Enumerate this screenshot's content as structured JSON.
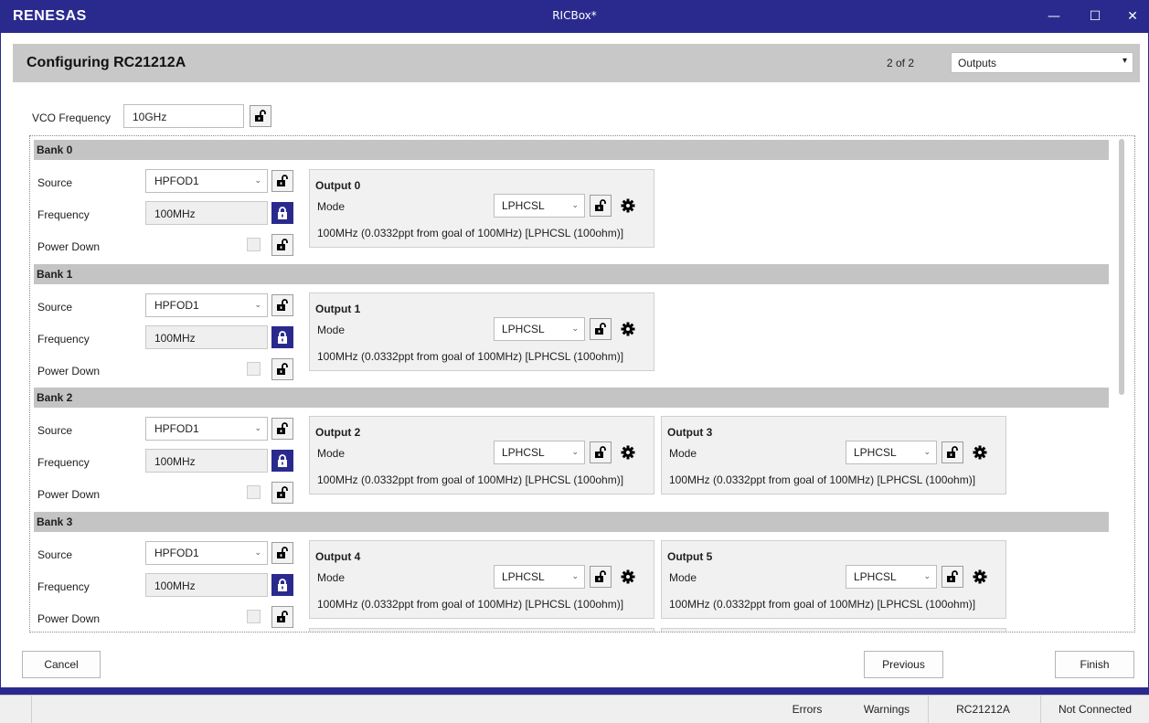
{
  "window": {
    "logo": "RENESAS",
    "title": "RICBox*"
  },
  "header": {
    "title": "Configuring RC21212A",
    "page_counter": "2 of 2",
    "page_select": "Outputs"
  },
  "vco": {
    "label": "VCO Frequency",
    "value": "10GHz"
  },
  "bank_labels": {
    "source": "Source",
    "frequency": "Frequency",
    "power_down": "Power Down"
  },
  "output_labels": {
    "mode": "Mode"
  },
  "banks": [
    {
      "name": "Bank 0",
      "source": "HPFOD1",
      "frequency": "100MHz",
      "outputs": [
        {
          "name": "Output 0",
          "mode": "LPHCSL",
          "summary": "100MHz (0.0332ppt from goal of 100MHz) [LPHCSL (100ohm)]"
        }
      ]
    },
    {
      "name": "Bank 1",
      "source": "HPFOD1",
      "frequency": "100MHz",
      "outputs": [
        {
          "name": "Output 1",
          "mode": "LPHCSL",
          "summary": "100MHz (0.0332ppt from goal of 100MHz) [LPHCSL (100ohm)]"
        }
      ]
    },
    {
      "name": "Bank 2",
      "source": "HPFOD1",
      "frequency": "100MHz",
      "outputs": [
        {
          "name": "Output 2",
          "mode": "LPHCSL",
          "summary": "100MHz (0.0332ppt from goal of 100MHz) [LPHCSL (100ohm)]"
        },
        {
          "name": "Output 3",
          "mode": "LPHCSL",
          "summary": "100MHz (0.0332ppt from goal of 100MHz) [LPHCSL (100ohm)]"
        }
      ]
    },
    {
      "name": "Bank 3",
      "source": "HPFOD1",
      "frequency": "100MHz",
      "outputs": [
        {
          "name": "Output 4",
          "mode": "LPHCSL",
          "summary": "100MHz (0.0332ppt from goal of 100MHz) [LPHCSL (100ohm)]"
        },
        {
          "name": "Output 5",
          "mode": "LPHCSL",
          "summary": "100MHz (0.0332ppt from goal of 100MHz) [LPHCSL (100ohm)]"
        }
      ]
    }
  ],
  "footer": {
    "cancel": "Cancel",
    "previous": "Previous",
    "finish": "Finish"
  },
  "status": {
    "errors": "Errors",
    "warnings": "Warnings",
    "device": "RC21212A",
    "connection": "Not Connected"
  },
  "colors": {
    "brand": "#2a2a8e",
    "bank_header": "#c4c4c4",
    "card": "#f1f1f1"
  }
}
